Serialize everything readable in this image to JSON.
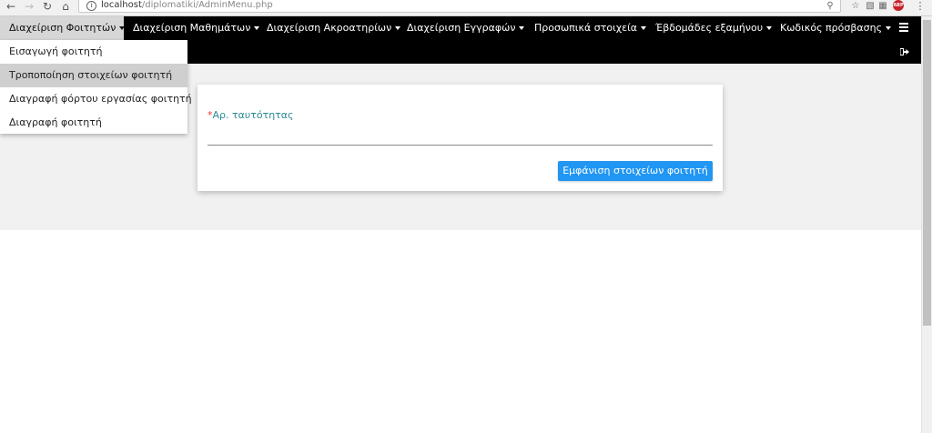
{
  "browser": {
    "url_host": "localhost",
    "url_path": "/diplomatiki/AdminMenu.php"
  },
  "navbar": {
    "items": [
      {
        "label": "Διαχείριση Φοιτητών"
      },
      {
        "label": "Διαχείριση Μαθημάτων"
      },
      {
        "label": "Διαχείριση Ακροατηρίων"
      },
      {
        "label": "Διαχείριση Εγγραφών"
      },
      {
        "label": "Προσωπικά στοιχεία"
      },
      {
        "label": "Έβδομάδες εξαμήνου"
      },
      {
        "label": "Κωδικός πρόσβασης"
      }
    ],
    "active_index": 0
  },
  "dropdown": {
    "items": [
      {
        "label": "Εισαγωγή φοιτητή"
      },
      {
        "label": "Τροποποίηση στοιχείων φοιτητή"
      },
      {
        "label": "Διαγραφή φόρτου εργασίας φοιτητή"
      },
      {
        "label": "Διαγραφή φοιτητή"
      }
    ],
    "hover_index": 1
  },
  "form": {
    "required_mark": "*",
    "id_label": "Αρ. ταυτότητας",
    "id_value": "",
    "submit_label": "Εμφάνιση στοιχείων φοιτητή"
  },
  "colors": {
    "navbar_bg": "#000000",
    "label": "#2b8a94",
    "required": "#e53935",
    "button": "#2196f3",
    "section_bg": "#f1f1f1"
  }
}
